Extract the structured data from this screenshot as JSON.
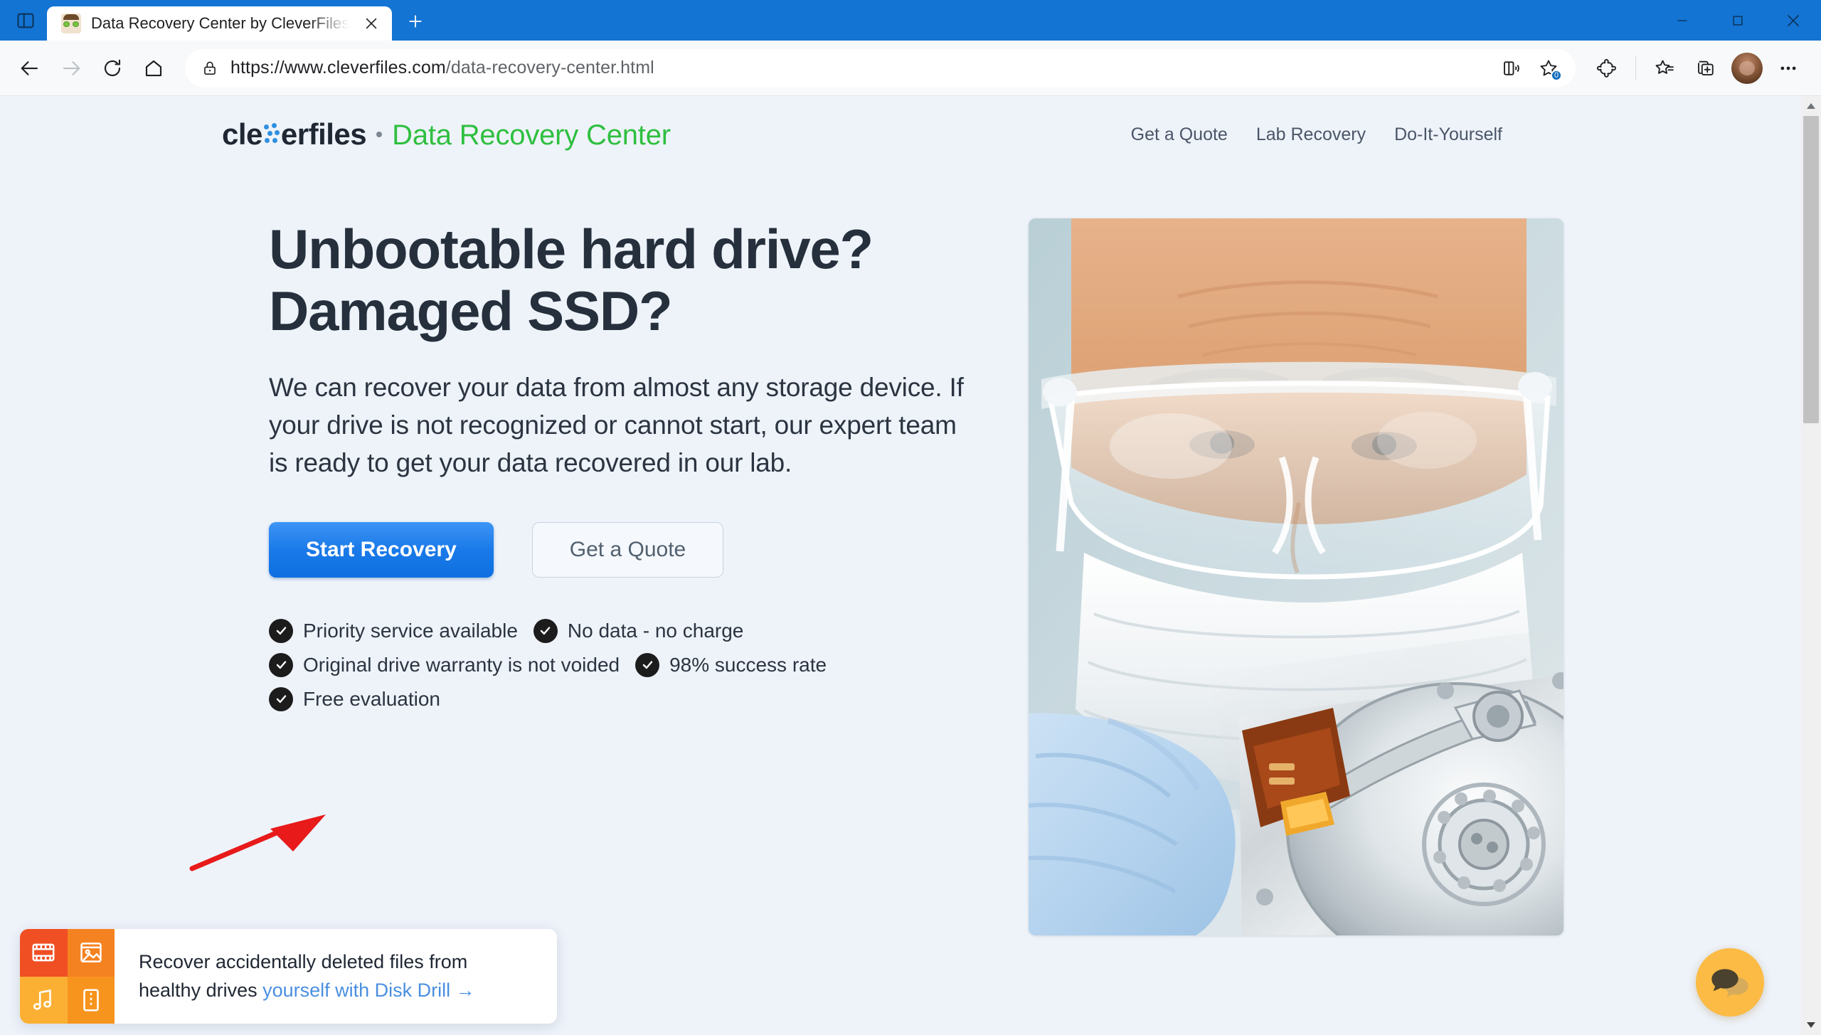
{
  "browser": {
    "tab_actions_icon": "split-screen-icon",
    "tab": {
      "title": "Data Recovery Center by CleverFiles",
      "favicon": "technician-face-favicon",
      "close_icon": "close-icon"
    },
    "new_tab_label": "+",
    "window_controls": {
      "minimize": "minimize-icon",
      "maximize": "maximize-icon",
      "close": "close-icon"
    },
    "nav": {
      "back": "back-arrow-icon",
      "forward": "forward-arrow-icon",
      "reload": "reload-icon",
      "home": "home-icon"
    },
    "omnibox": {
      "lock_icon": "lock-icon",
      "url_full": "https://www.cleverfiles.com/data-recovery-center.html",
      "url_scheme_host": "https://www.cleverfiles.com",
      "url_path": "/data-recovery-center.html",
      "read_aloud_icon": "read-aloud-icon",
      "add_favorite_icon": "add-to-favorites-icon",
      "add_favorite_badge": "0"
    },
    "toolbar_right": {
      "extensions_icon": "extensions-puzzle-icon",
      "favorites_icon": "favorites-star-icon",
      "collections_icon": "collections-icon",
      "profile_icon": "profile-avatar",
      "settings_icon": "more-options-icon"
    },
    "titlebar_color": "#1374d3"
  },
  "site": {
    "brand": {
      "word_before": "cle",
      "word_after": "erfiles",
      "separator": "•",
      "subtitle": "Data Recovery Center",
      "subtitle_color": "#2fbf3f",
      "dots_color": "#2f8fe0"
    },
    "nav": [
      {
        "label": "Get a Quote"
      },
      {
        "label": "Lab Recovery"
      },
      {
        "label": "Do-It-Yourself"
      }
    ]
  },
  "hero": {
    "title": "Unbootable hard drive? Damaged SSD?",
    "paragraph": "We can recover your data from almost any storage device. If your drive is not recognized or cannot start, our expert team is ready to get your data recovered in our lab.",
    "primary_cta": "Start Recovery",
    "secondary_cta": "Get a Quote",
    "primary_cta_color": "#1a7ae8",
    "features": [
      [
        "Priority service available",
        "No data - no charge"
      ],
      [
        "Original drive warranty is not voided",
        "98% success rate"
      ],
      [
        "Free evaluation"
      ]
    ],
    "photo_alt": "lab technician in goggles and mask repairing an opened hard drive"
  },
  "promo": {
    "text_line1": "Recover accidentally deleted files from",
    "text_line2_prefix": "healthy drives ",
    "link_text": "yourself with Disk Drill →",
    "link_color": "#4a8fe0",
    "tile_colors": [
      "#f04e23",
      "#f58220",
      "#fbb034",
      "#f7941e"
    ]
  },
  "chat": {
    "icon": "chat-bubbles-icon",
    "bg_color": "#fbbb44"
  },
  "annotation": {
    "arrow": "red-pointer-arrow",
    "color": "#e81a1a"
  },
  "scrollbar": {
    "up_icon": "scroll-up-arrow",
    "down_icon": "scroll-down-arrow"
  }
}
